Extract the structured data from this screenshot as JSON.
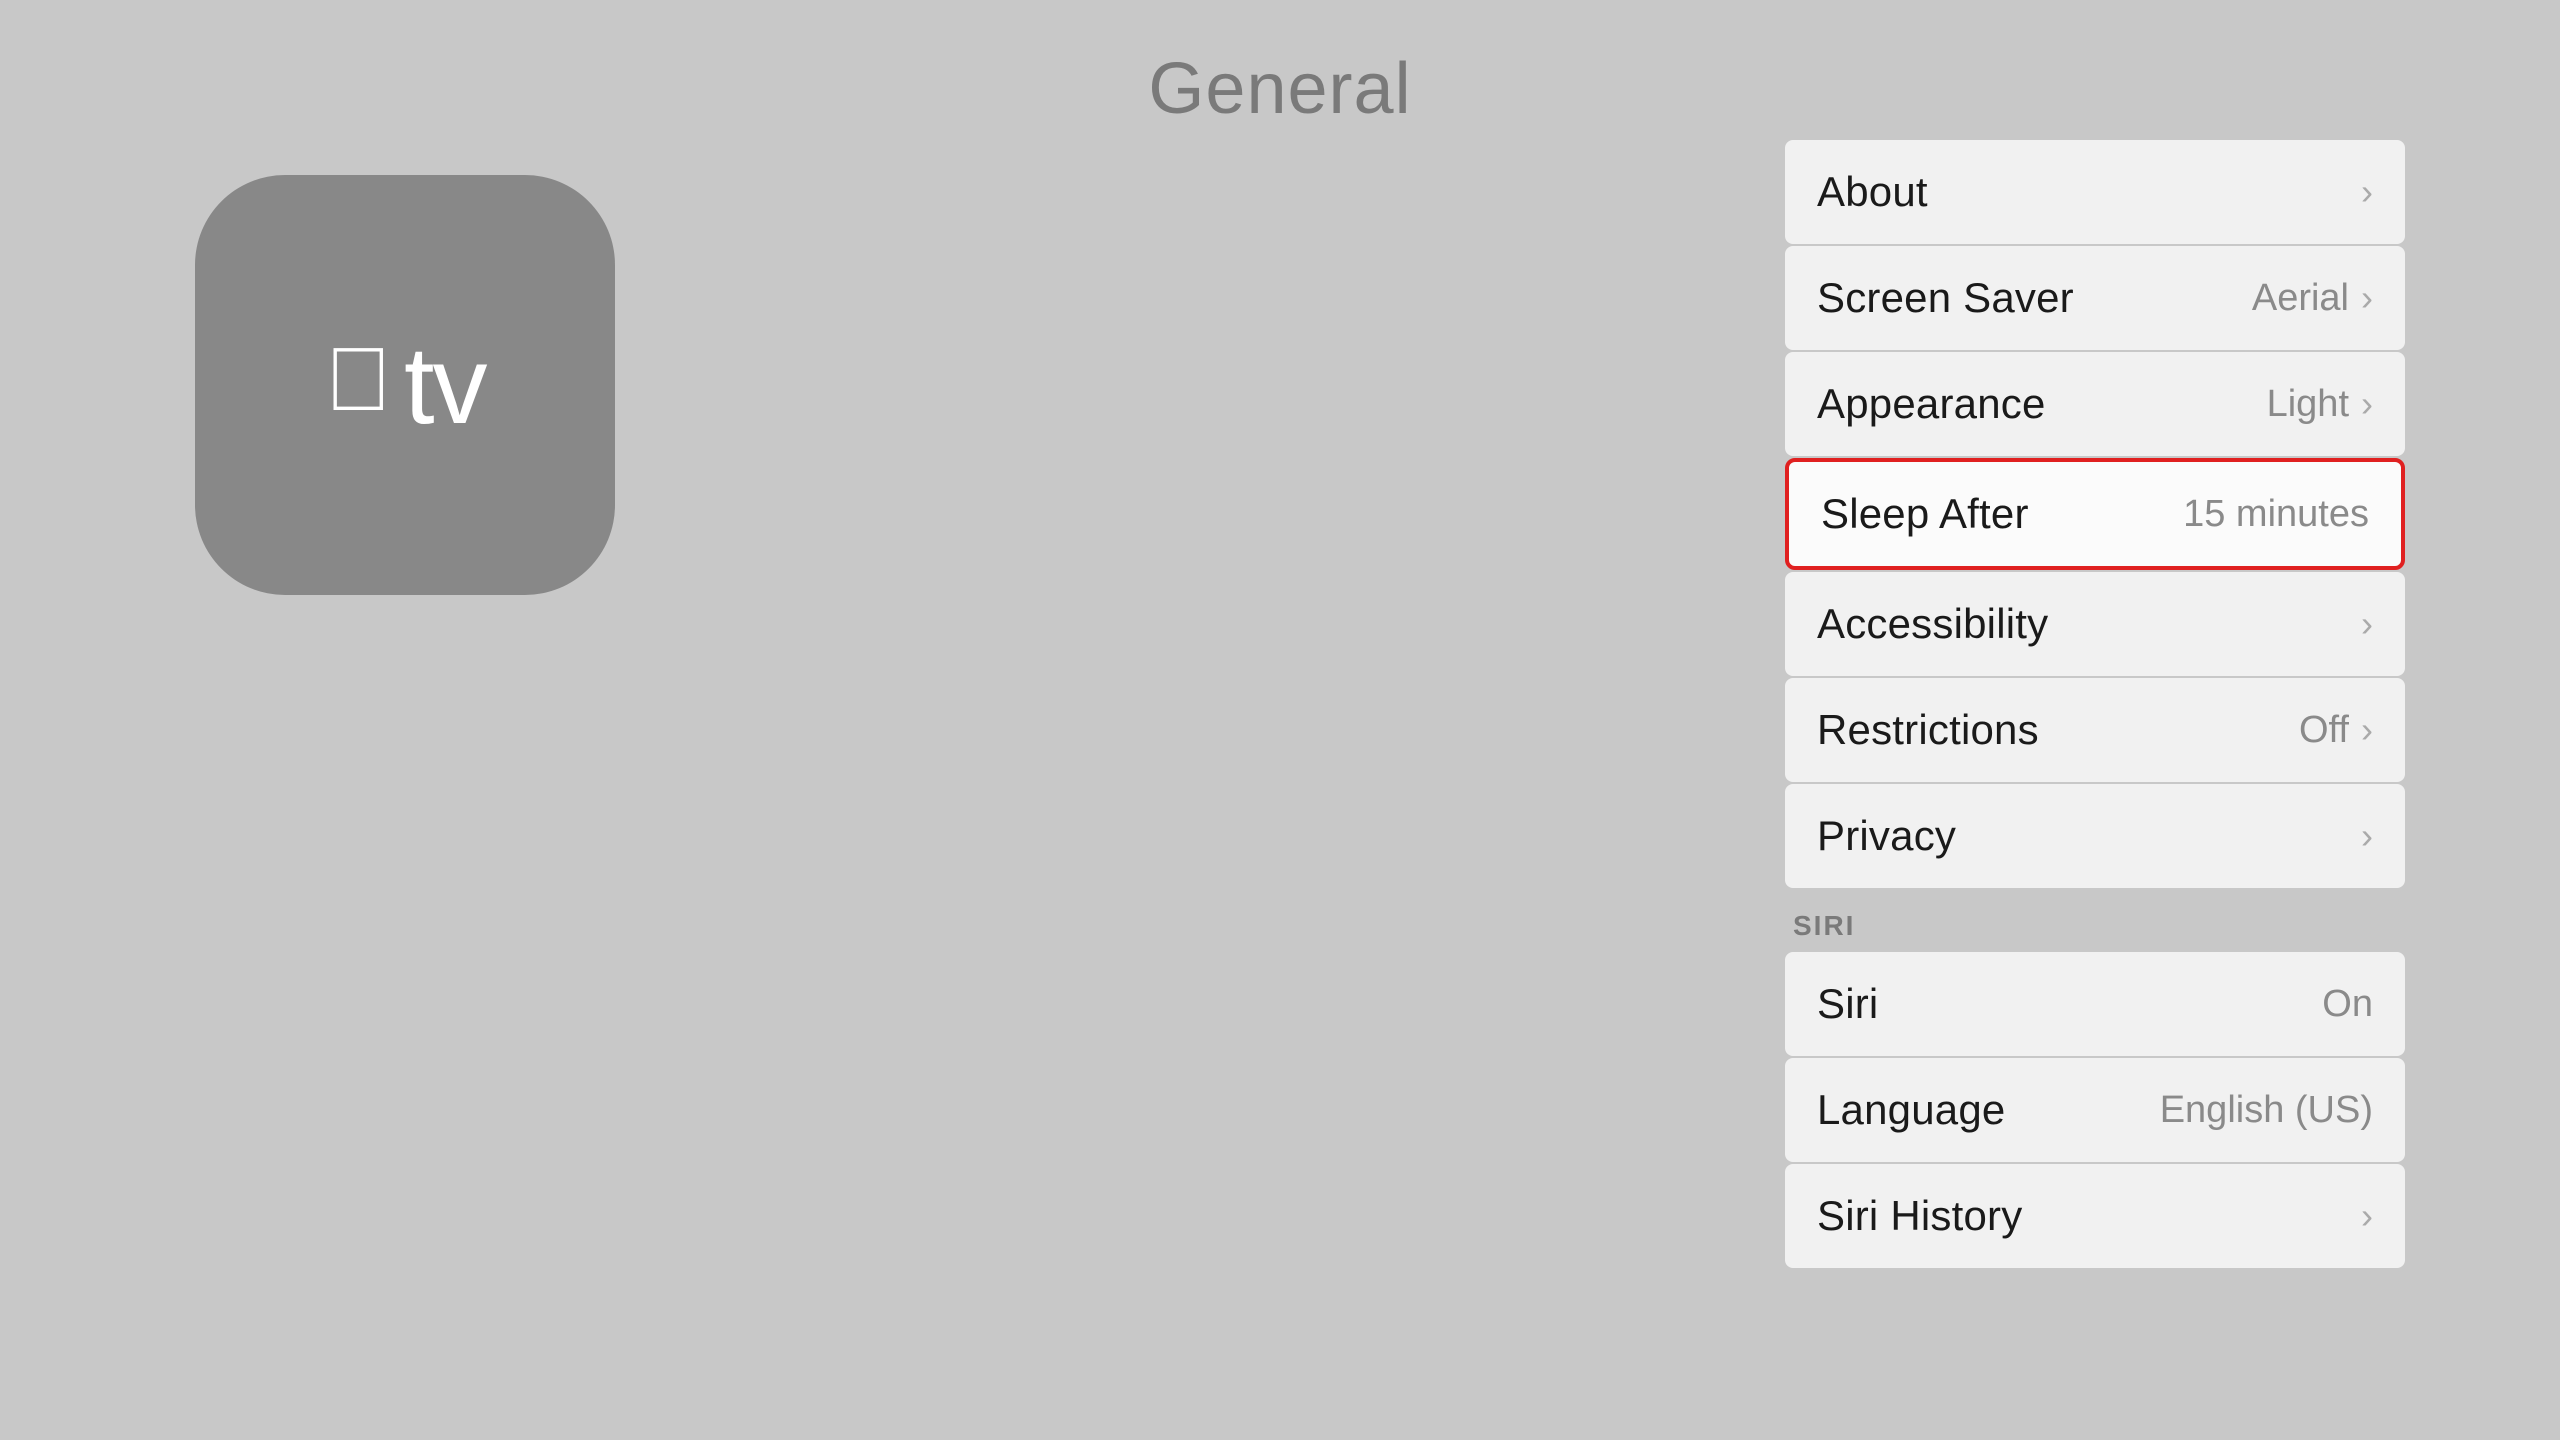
{
  "page": {
    "title": "General"
  },
  "logo": {
    "apple_symbol": "",
    "tv_label": "tv"
  },
  "settings": {
    "items": [
      {
        "id": "about",
        "label": "About",
        "value": "",
        "has_chevron": true,
        "selected": false,
        "group": "main"
      },
      {
        "id": "screen-saver",
        "label": "Screen Saver",
        "value": "Aerial",
        "has_chevron": true,
        "selected": false,
        "group": "main"
      },
      {
        "id": "appearance",
        "label": "Appearance",
        "value": "Light",
        "has_chevron": true,
        "selected": false,
        "group": "main"
      },
      {
        "id": "sleep-after",
        "label": "Sleep After",
        "value": "15 minutes",
        "has_chevron": false,
        "selected": true,
        "group": "main"
      },
      {
        "id": "accessibility",
        "label": "Accessibility",
        "value": "",
        "has_chevron": true,
        "selected": false,
        "group": "main"
      },
      {
        "id": "restrictions",
        "label": "Restrictions",
        "value": "Off",
        "has_chevron": true,
        "selected": false,
        "group": "main"
      },
      {
        "id": "privacy",
        "label": "Privacy",
        "value": "",
        "has_chevron": true,
        "selected": false,
        "group": "main"
      }
    ],
    "siri_section_label": "SIRI",
    "siri_items": [
      {
        "id": "siri",
        "label": "Siri",
        "value": "On",
        "has_chevron": false,
        "selected": false
      },
      {
        "id": "language",
        "label": "Language",
        "value": "English (US)",
        "has_chevron": false,
        "selected": false
      },
      {
        "id": "siri-history",
        "label": "Siri History",
        "value": "",
        "has_chevron": true,
        "selected": false
      }
    ]
  }
}
